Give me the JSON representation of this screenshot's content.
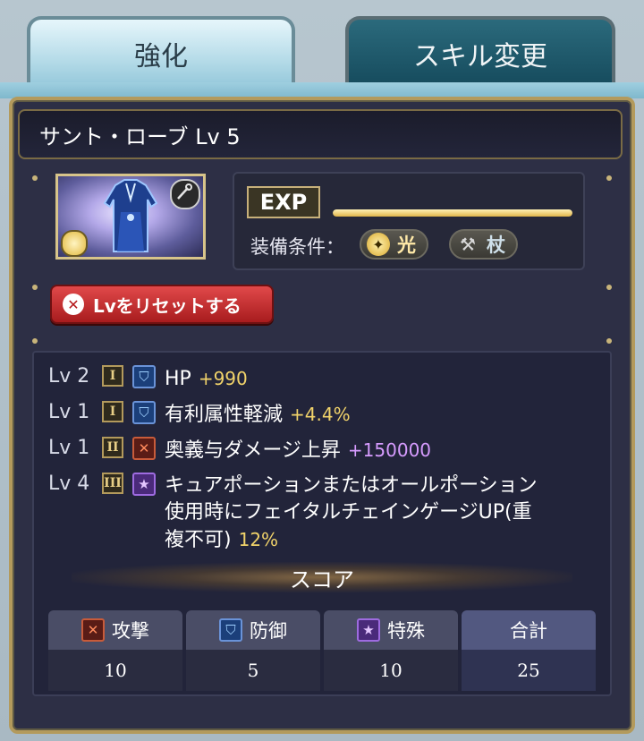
{
  "tabs": [
    {
      "label": "強化",
      "active": true
    },
    {
      "label": "スキル変更",
      "active": false
    }
  ],
  "item": {
    "title": "サント・ローブ Lv 5",
    "exp_label": "EXP",
    "exp_progress": 1.0,
    "equip_condition_label": "装備条件：",
    "equip_conditions": [
      {
        "label": "光",
        "icon": "light-element-icon"
      },
      {
        "label": "杖",
        "icon": "staff-icon"
      }
    ]
  },
  "reset_button": {
    "label": "Lvをリセットする",
    "icon": "close-circle-icon"
  },
  "skills": [
    {
      "level": "Lv 2",
      "rank": "I",
      "type": "defense",
      "name": "HP",
      "bonus": "+990",
      "bonus_color": "#f1d36a"
    },
    {
      "level": "Lv 1",
      "rank": "I",
      "type": "defense",
      "name": "有利属性軽減",
      "bonus": "+4.4%",
      "bonus_color": "#f1d36a"
    },
    {
      "level": "Lv 1",
      "rank": "II",
      "type": "attack",
      "name": "奥義与ダメージ上昇",
      "bonus": "+150000",
      "bonus_color": "#d79cff"
    },
    {
      "level": "Lv 4",
      "rank": "III",
      "type": "special",
      "name_lines": [
        "キュアポーションまたはオールポーション",
        "使用時にフェイタルチェインゲージUP(重",
        "複不可)"
      ],
      "bonus": "12%",
      "bonus_color": "#f1d36a"
    }
  ],
  "score": {
    "title": "スコア",
    "columns": [
      {
        "label": "攻撃",
        "icon": "attack-icon",
        "value": "10"
      },
      {
        "label": "防御",
        "icon": "shield-icon",
        "value": "5"
      },
      {
        "label": "特殊",
        "icon": "star-icon",
        "value": "10"
      },
      {
        "label": "合計",
        "value": "25"
      }
    ]
  }
}
